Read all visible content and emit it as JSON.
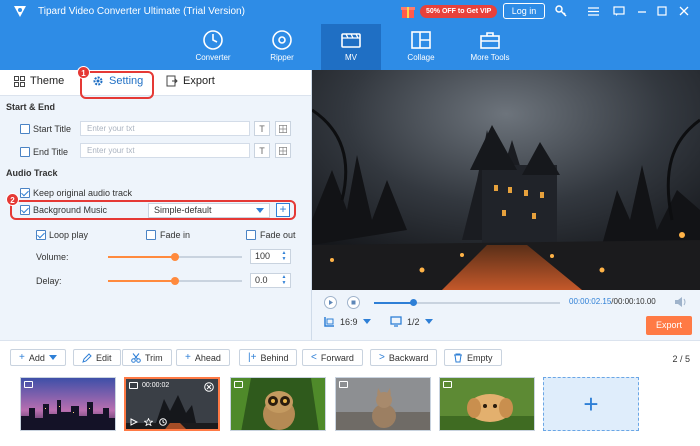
{
  "app": {
    "title": "Tipard Video Converter Ultimate (Trial Version)",
    "promo": "50% OFF to Get VIP",
    "login": "Log in",
    "accent": "#2e8ce6"
  },
  "nav": {
    "tabs": [
      {
        "label": "Converter",
        "icon": "converter-icon"
      },
      {
        "label": "Ripper",
        "icon": "ripper-icon"
      },
      {
        "label": "MV",
        "icon": "mv-icon",
        "active": true
      },
      {
        "label": "Collage",
        "icon": "collage-icon"
      },
      {
        "label": "More Tools",
        "icon": "toolbox-icon"
      }
    ]
  },
  "mv_tabs": {
    "theme": "Theme",
    "setting": "Setting",
    "export": "Export"
  },
  "markers": {
    "one": "1",
    "two": "2"
  },
  "start_end": {
    "title": "Start & End",
    "start_label": "Start Title",
    "end_label": "End Title",
    "placeholder": "Enter your txt",
    "t_glyph": "T"
  },
  "audio": {
    "title": "Audio Track",
    "keep_original": "Keep original audio track",
    "keep_original_checked": true,
    "background_music": "Background Music",
    "background_music_checked": true,
    "music_value": "Simple-default",
    "add_glyph": "+",
    "loop_play": "Loop play",
    "loop_play_checked": true,
    "fade_in": "Fade in",
    "fade_in_checked": false,
    "fade_out": "Fade out",
    "fade_out_checked": false,
    "volume_label": "Volume:",
    "volume_value": "100",
    "volume_level": 0.5,
    "delay_label": "Delay:",
    "delay_value": "0.0",
    "delay_level": 0.5
  },
  "player": {
    "time_current": "00:00:02.15",
    "time_total": "/00:00:10.00",
    "progress": 0.215,
    "aspect": "16:9",
    "page": "1/2",
    "export": "Export"
  },
  "toolbar": {
    "add": "Add",
    "edit": "Edit",
    "trim": "Trim",
    "ahead": "Ahead",
    "behind": "Behind",
    "forward": "Forward",
    "backward": "Backward",
    "empty": "Empty",
    "count": "2 / 5"
  },
  "timeline": {
    "active_duration": "00:00:02",
    "add_glyph": "+"
  }
}
